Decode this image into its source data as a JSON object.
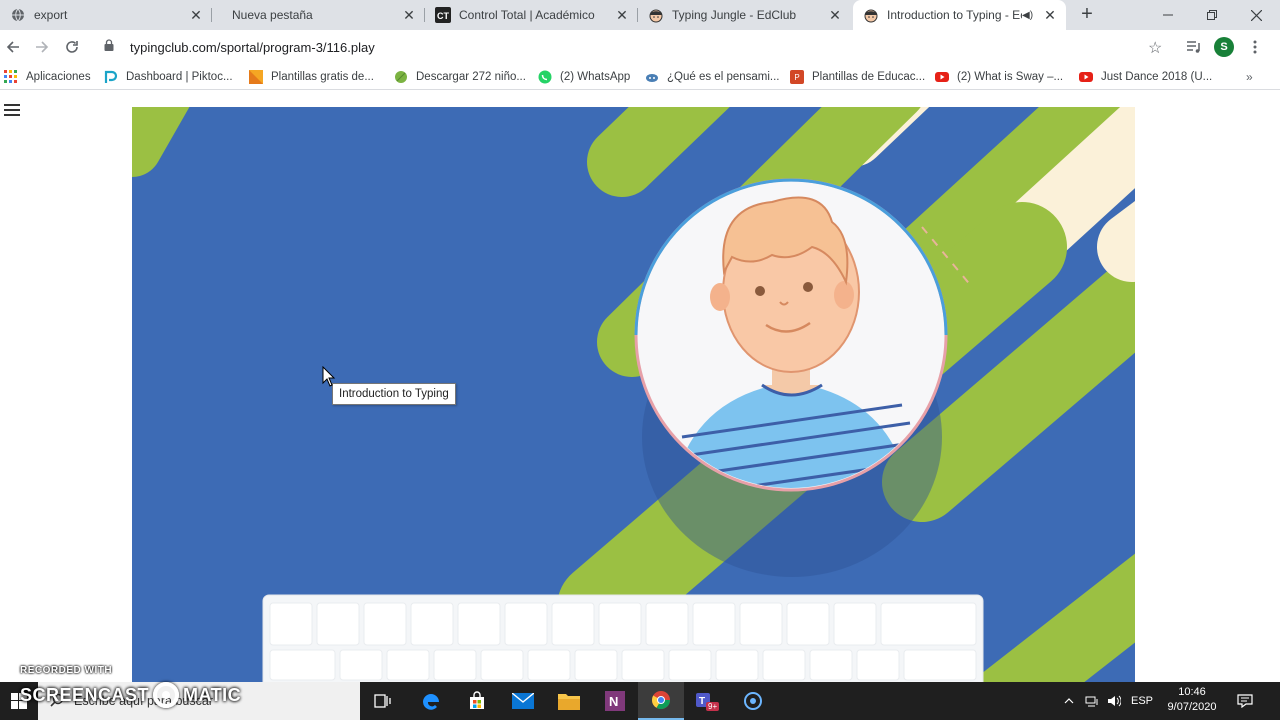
{
  "tabs": [
    {
      "label": "export",
      "icon": "globe-icon"
    },
    {
      "label": "Nueva pestaña",
      "icon": "none"
    },
    {
      "label": "Control Total | Académico",
      "icon": "ct-logo-icon"
    },
    {
      "label": "Typing Jungle - EdClub",
      "icon": "edclub-face-icon"
    },
    {
      "label": "Introduction to Typing - Ec",
      "icon": "edclub-face-icon",
      "active": true
    }
  ],
  "address_bar": {
    "url": "typingclub.com/sportal/program-3/116.play"
  },
  "profile": {
    "initial": "S",
    "color": "#188038"
  },
  "bookmarks": [
    {
      "label": "Aplicaciones",
      "icon": "apps-grid-icon"
    },
    {
      "label": "Dashboard | Piktoc...",
      "icon": "piktochart-icon",
      "color": "#1ba4c8"
    },
    {
      "label": "Plantillas gratis de...",
      "icon": "slidesgo-icon",
      "color": "#f5a623"
    },
    {
      "label": "Descargar 272 niño...",
      "icon": "leaf-icon",
      "color": "#7cb342"
    },
    {
      "label": "(2) WhatsApp",
      "icon": "whatsapp-icon",
      "color": "#25d366"
    },
    {
      "label": "¿Qué es el pensami...",
      "icon": "cloud-icon",
      "color": "#4a7fb5"
    },
    {
      "label": "Plantillas de Educac...",
      "icon": "powerpoint-icon",
      "color": "#d24726"
    },
    {
      "label": "(2) What is Sway –...",
      "icon": "youtube-icon",
      "color": "#e62117"
    },
    {
      "label": "Just Dance 2018 (U...",
      "icon": "youtube-icon",
      "color": "#e62117"
    }
  ],
  "lesson": {
    "tooltip": "Introduction to Typing"
  },
  "colors": {
    "stage_blue": "#3d6bb5",
    "stripe_green": "#9bc043",
    "stripe_cream": "#fbf1d9"
  },
  "watermark": {
    "line1": "RECORDED WITH",
    "line2_left": "SCREENCAST",
    "line2_right": "MATIC"
  },
  "taskbar": {
    "search_placeholder": "Escribe aquí para buscar",
    "apps": [
      "task-view-icon",
      "edge-icon",
      "store-icon",
      "mail-icon",
      "file-explorer-icon",
      "onenote-icon",
      "chrome-icon",
      "teams-icon",
      "screencast-icon"
    ],
    "teams_badge": "9+",
    "language": "ESP",
    "time": "10:46",
    "date": "9/07/2020"
  }
}
